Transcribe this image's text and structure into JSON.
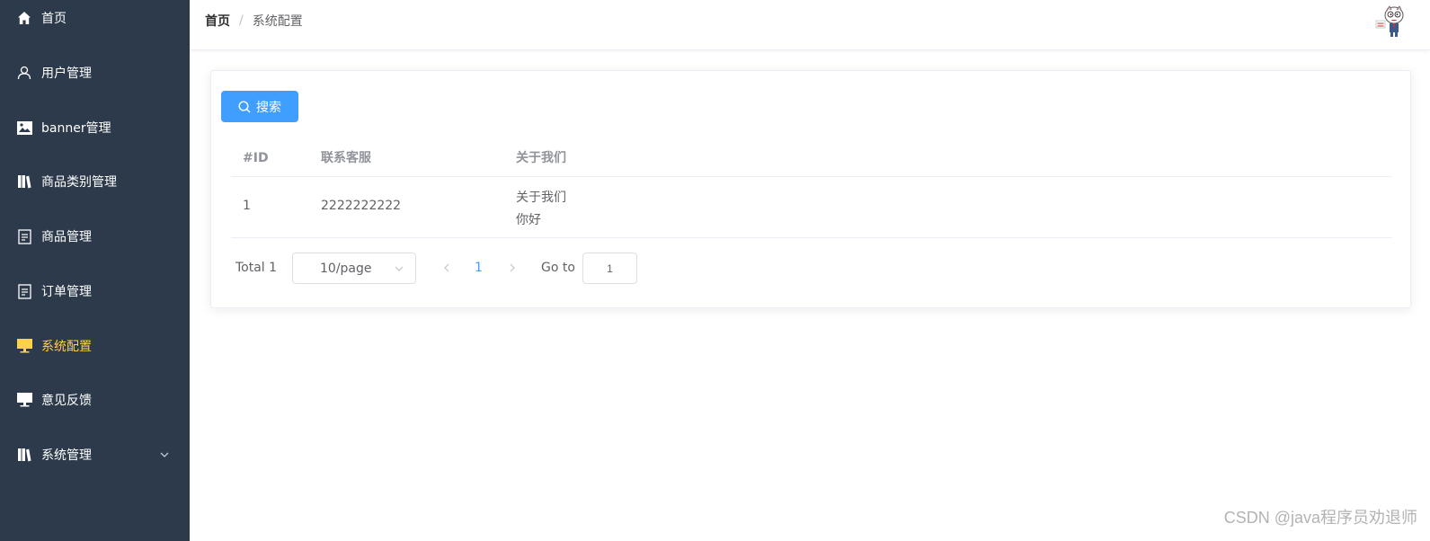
{
  "sidebar": {
    "items": [
      {
        "label": "首页",
        "icon": "home-icon"
      },
      {
        "label": "用户管理",
        "icon": "user-icon"
      },
      {
        "label": "banner管理",
        "icon": "image-icon"
      },
      {
        "label": "商品类别管理",
        "icon": "collection-icon"
      },
      {
        "label": "商品管理",
        "icon": "document-icon"
      },
      {
        "label": "订单管理",
        "icon": "document-icon"
      },
      {
        "label": "系统配置",
        "icon": "monitor-icon"
      },
      {
        "label": "意见反馈",
        "icon": "monitor-icon"
      },
      {
        "label": "系统管理",
        "icon": "collection-icon"
      }
    ],
    "active_label": "系统配置",
    "active_color": "#ffd04b",
    "background": "#2d3a4b"
  },
  "header": {
    "breadcrumb": {
      "home": "首页",
      "separator": "/",
      "current": "系统配置"
    }
  },
  "toolbar": {
    "search_label": "搜索",
    "accent": "#409eff"
  },
  "table": {
    "columns": [
      "#ID",
      "联系客服",
      "关于我们"
    ],
    "rows": [
      {
        "id": "1",
        "contact": "2222222222",
        "about_line1": "关于我们",
        "about_line2": "你好"
      }
    ]
  },
  "pagination": {
    "total": "Total 1",
    "page_size": "10/page",
    "current_page": "1",
    "goto_label": "Go to",
    "goto_value": "1"
  },
  "watermark": "CSDN @java程序员劝退师"
}
